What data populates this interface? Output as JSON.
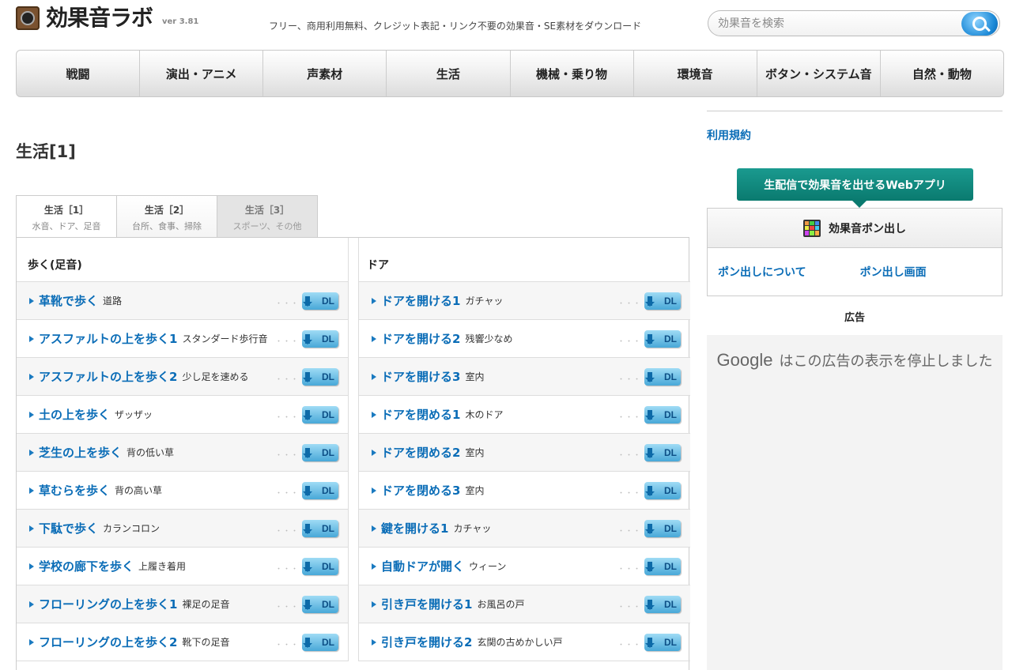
{
  "header": {
    "logo_text": "効果音ラボ",
    "version": "ver 3.81",
    "tagline": "フリー、商用利用無料、クレジット表記・リンク不要の効果音・SE素材をダウンロード",
    "search_placeholder": "効果音を検索"
  },
  "nav": {
    "items": [
      "戦闘",
      "演出・アニメ",
      "声素材",
      "生活",
      "機械・乗り物",
      "環境音",
      "ボタン・システム音",
      "自然・動物"
    ]
  },
  "main": {
    "title": "生活[1]",
    "tabs": [
      {
        "name": "生活［1］",
        "sub": "水音、ドア、足音"
      },
      {
        "name": "生活［2］",
        "sub": "台所、食事、掃除"
      },
      {
        "name": "生活［3］",
        "sub": "スポーツ、その他"
      }
    ],
    "dl_label": "DL",
    "dots": "・・・",
    "columns": [
      {
        "heading": "歩く(足音)",
        "rows": [
          {
            "name": "革靴で歩く",
            "note": "道路"
          },
          {
            "name": "アスファルトの上を歩く1",
            "note": "スタンダード歩行音"
          },
          {
            "name": "アスファルトの上を歩く2",
            "note": "少し足を速める"
          },
          {
            "name": "土の上を歩く",
            "note": "ザッザッ"
          },
          {
            "name": "芝生の上を歩く",
            "note": "背の低い草"
          },
          {
            "name": "草むらを歩く",
            "note": "背の高い草"
          },
          {
            "name": "下駄で歩く",
            "note": "カランコロン"
          },
          {
            "name": "学校の廊下を歩く",
            "note": "上履き着用"
          },
          {
            "name": "フローリングの上を歩く1",
            "note": "裸足の足音"
          },
          {
            "name": "フローリングの上を歩く2",
            "note": "靴下の足音"
          }
        ]
      },
      {
        "heading": "ドア",
        "rows": [
          {
            "name": "ドアを開ける1",
            "note": "ガチャッ"
          },
          {
            "name": "ドアを開ける2",
            "note": "残響少なめ"
          },
          {
            "name": "ドアを開ける3",
            "note": "室内"
          },
          {
            "name": "ドアを閉める1",
            "note": "木のドア"
          },
          {
            "name": "ドアを閉める2",
            "note": "室内"
          },
          {
            "name": "ドアを閉める3",
            "note": "室内"
          },
          {
            "name": "鍵を開ける1",
            "note": "カチャッ"
          },
          {
            "name": "自動ドアが開く",
            "note": "ウィーン"
          },
          {
            "name": "引き戸を開ける1",
            "note": "お風呂の戸"
          },
          {
            "name": "引き戸を開ける2",
            "note": "玄関の古めかしい戸"
          }
        ]
      }
    ]
  },
  "sidebar": {
    "terms": "利用規約",
    "promo": "生配信で効果音を出せるWebアプリ",
    "ponbox_title": "効果音ポン出し",
    "link_about": "ポン出しについて",
    "link_screen": "ポン出し画面",
    "ad_label": "広告",
    "ad_brand": "Google",
    "ad_message": "はこの広告の表示を停止しました"
  },
  "colors": {
    "link": "#0b6db7",
    "promo": "#0a7a6f",
    "dl_button": "#48a8d8"
  }
}
